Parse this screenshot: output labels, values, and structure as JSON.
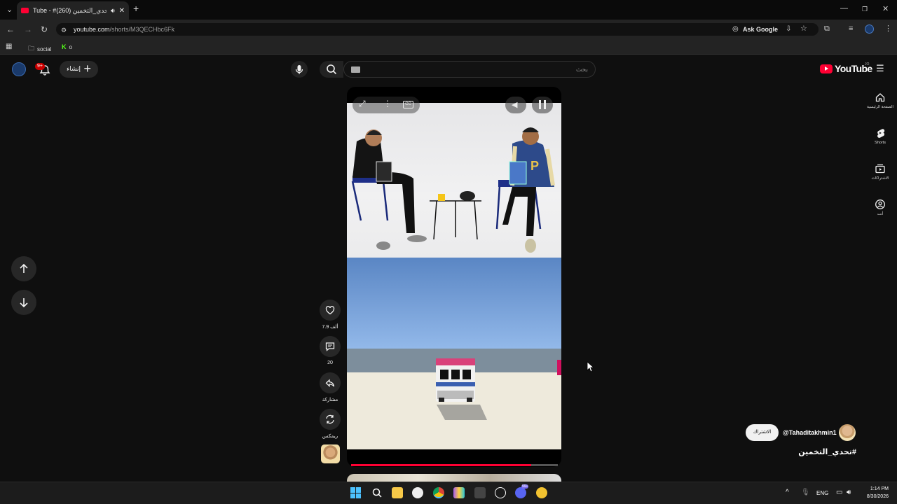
{
  "browser": {
    "tab_title": "Tube - #تحدي_التخمين (260)",
    "url_host": "youtube.com",
    "url_path": "/shorts/M3QECHbc6Fk",
    "ask_google": "Ask Google",
    "bookmarks": [
      {
        "label": "social"
      },
      {
        "label": "o"
      }
    ]
  },
  "youtube": {
    "logo_text": "YouTube",
    "country_code": "JO",
    "search_placeholder": "بحث",
    "create_label": "إنشاء",
    "notification_badge": "9+",
    "right_nav": [
      {
        "label": "الصفحة الرئيسية",
        "icon": "home-icon"
      },
      {
        "label": "Shorts",
        "icon": "shorts-icon"
      },
      {
        "label": "الاشتراكات",
        "icon": "subscriptions-icon"
      },
      {
        "label": "أنت",
        "icon": "you-icon"
      }
    ]
  },
  "short": {
    "progress": 0.87,
    "actions": {
      "like_count": "7.9 ألف",
      "comment_count": "20",
      "share_label": "مشاركة",
      "remix_label": "ريمكس"
    },
    "channel_handle": "@Tahaditakhmin1",
    "subscribe_label": "الاشتراك",
    "title": "#تحدي_التخمين"
  },
  "taskbar": {
    "language": "ENG",
    "time": "1:14 PM",
    "date": "8/30/2026",
    "discord_badge": "99+"
  },
  "colors": {
    "yt_red": "#ff0033",
    "bg": "#0f0f0f",
    "chip": "#272727"
  }
}
